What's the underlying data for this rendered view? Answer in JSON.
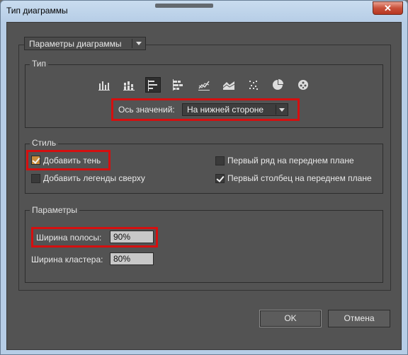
{
  "window": {
    "title": "Тип диаграммы",
    "close": "✕"
  },
  "header_dropdown": {
    "label": "Параметры диаграммы"
  },
  "type_group": {
    "legend": "Тип",
    "icons": [
      "column-chart-icon",
      "stacked-column-chart-icon",
      "bar-chart-icon",
      "stacked-bar-chart-icon",
      "line-chart-icon",
      "area-chart-icon",
      "scatter-chart-icon",
      "pie-chart-icon",
      "radar-chart-icon"
    ],
    "active_icon": "bar-chart-icon",
    "value_axis_label": "Ось значений:",
    "value_axis_value": "На нижней стороне"
  },
  "style_group": {
    "legend": "Стиль",
    "add_shadow": "Добавить тень",
    "add_legend_top": "Добавить легенды сверху",
    "first_row_front": "Первый ряд на переднем плане",
    "first_column_front": "Первый столбец на переднем плане",
    "checked": {
      "add_shadow": true,
      "add_legend_top": false,
      "first_row_front": false,
      "first_column_front": true
    }
  },
  "params_group": {
    "legend": "Параметры",
    "bar_width_label": "Ширина полосы:",
    "bar_width_value": "90%",
    "cluster_width_label": "Ширина кластера:",
    "cluster_width_value": "80%"
  },
  "buttons": {
    "ok": "OK",
    "cancel": "Отмена"
  },
  "colors": {
    "highlight": "#d50f0f",
    "panel_bg": "#535353"
  }
}
